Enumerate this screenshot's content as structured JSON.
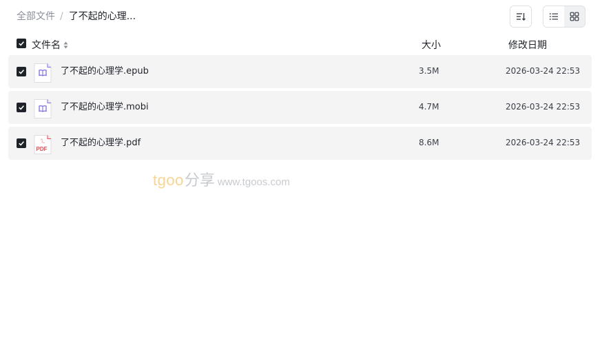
{
  "breadcrumb": {
    "root": "全部文件",
    "separator": "/",
    "current": "了不起的心理..."
  },
  "toolbar": {
    "sort_icon": "sort-descending-icon",
    "list_view_icon": "list-view-icon",
    "grid_view_icon": "grid-view-icon",
    "active_view": "list"
  },
  "header": {
    "name": "文件名",
    "size": "大小",
    "date": "修改日期"
  },
  "files": [
    {
      "name": "了不起的心理学.epub",
      "size": "3.5M",
      "date": "2026-03-24 22:53",
      "type": "ebook",
      "checked": true
    },
    {
      "name": "了不起的心理学.mobi",
      "size": "4.7M",
      "date": "2026-03-24 22:53",
      "type": "ebook",
      "checked": true
    },
    {
      "name": "了不起的心理学.pdf",
      "size": "8.6M",
      "date": "2026-03-24 22:53",
      "type": "pdf",
      "checked": true
    }
  ],
  "pdf_icon_label": "PDF",
  "watermark": {
    "brand": "tgoo",
    "share": "分享",
    "url": "www.tgoos.com"
  },
  "colors": {
    "row_bg": "#f4f4f5",
    "checkbox": "#1f2329",
    "ebook_icon": "#7b6ee0",
    "pdf_icon": "#e5484d",
    "watermark_brand": "#f3b23a"
  }
}
